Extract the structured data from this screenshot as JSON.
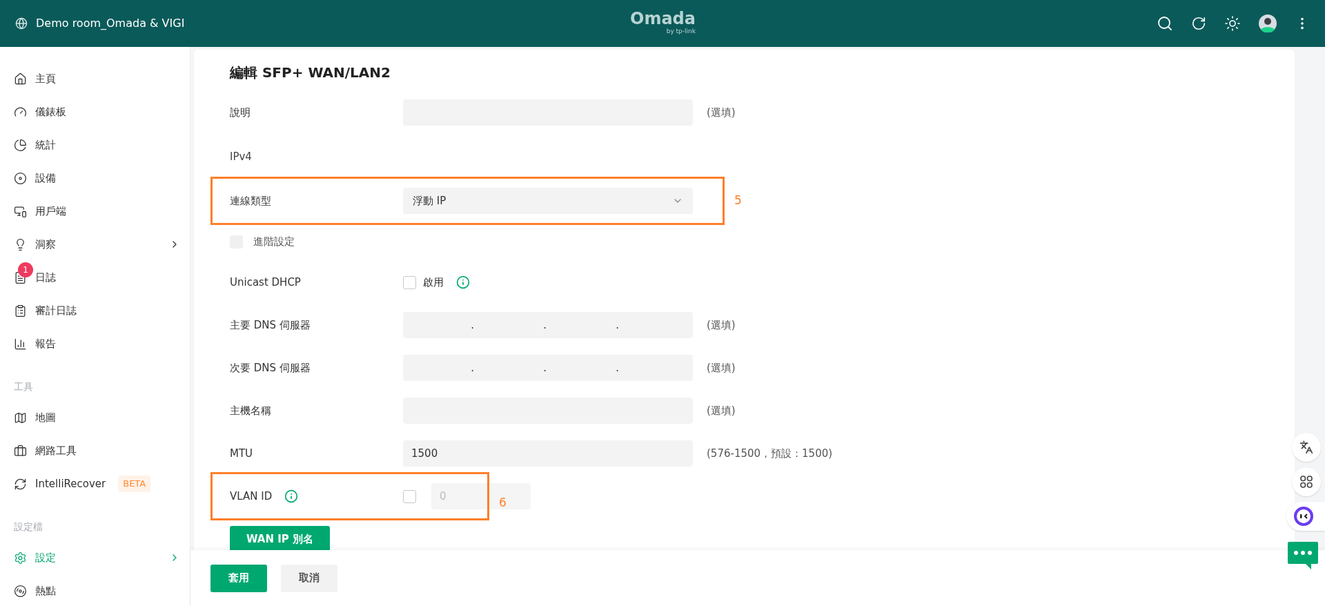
{
  "header": {
    "site": "Demo room_Omada & VIGI",
    "logo": "Omada",
    "logo_sub": "by tp-link"
  },
  "sidebar": {
    "sections": [
      {
        "items": [
          {
            "label": "主頁",
            "selected": false
          },
          {
            "label": "儀錶板",
            "selected": false
          },
          {
            "label": "統計",
            "selected": false
          },
          {
            "label": "設備",
            "selected": false
          },
          {
            "label": "用戶端",
            "selected": false
          },
          {
            "label": "洞察",
            "selected": false,
            "expandable": true
          },
          {
            "label": "日誌",
            "selected": false,
            "badge": "1"
          },
          {
            "label": "審計日誌",
            "selected": false
          },
          {
            "label": "報告",
            "selected": false
          }
        ]
      },
      {
        "title": "工具",
        "items": [
          {
            "label": "地圖",
            "selected": false
          },
          {
            "label": "網路工具",
            "selected": false
          },
          {
            "label": "IntelliRecover",
            "selected": false,
            "tag": "BETA"
          }
        ]
      },
      {
        "title": "設定檔",
        "items": [
          {
            "label": "設定",
            "selected": true,
            "expandable": true
          },
          {
            "label": "熱點",
            "selected": false
          }
        ]
      }
    ]
  },
  "form": {
    "title": "編輯 SFP+ WAN/LAN2",
    "rows": [
      {
        "kind": "input",
        "label": "說明",
        "note": "(選填)"
      },
      {
        "kind": "heading",
        "label": "IPv4"
      },
      {
        "kind": "select",
        "label": "連線類型",
        "value": "浮動 IP",
        "annotation": "5"
      },
      {
        "kind": "checkbox",
        "label": "進階設定",
        "checked": false,
        "disabled": true
      },
      {
        "kind": "check-field",
        "label": "Unicast DHCP",
        "option": "啟用",
        "checked": false,
        "info": true
      },
      {
        "kind": "ip",
        "label": "主要 DNS 伺服器",
        "separators": [
          ".",
          ".",
          "."
        ],
        "note": "(選填)"
      },
      {
        "kind": "ip",
        "label": "次要 DNS 伺服器",
        "separators": [
          ".",
          ".",
          "."
        ],
        "note": "(選填)"
      },
      {
        "kind": "input",
        "label": "主機名稱",
        "note": "(選填)"
      },
      {
        "kind": "input",
        "label": "MTU",
        "value": "1500",
        "note": "(576-1500，預設：1500)"
      },
      {
        "kind": "vlan",
        "label": "VLAN ID",
        "info": true,
        "checked": false,
        "placeholder": "0",
        "disabled": true,
        "annotation": "6"
      },
      {
        "kind": "button",
        "label": "WAN IP 別名"
      }
    ]
  },
  "footer": {
    "buttons": [
      {
        "label": "套用",
        "kind": "primary"
      },
      {
        "label": "取消",
        "kind": "secondary"
      }
    ]
  }
}
